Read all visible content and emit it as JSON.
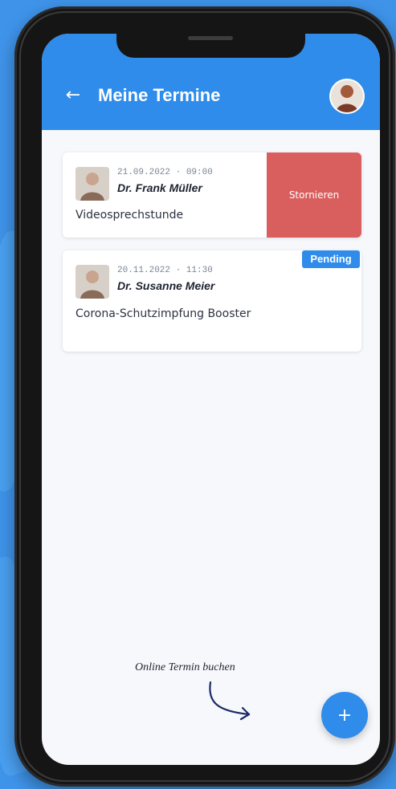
{
  "header": {
    "title": "Meine Termine",
    "back_icon": "arrow-left-icon",
    "avatar_icon": "user-avatar-icon"
  },
  "appointments": [
    {
      "date": "21.09.2022 · 09:00",
      "doctor": "Dr. Frank Müller",
      "reason": "Videosprechstunde",
      "cancel_label": "Stornieren"
    },
    {
      "date": "20.11.2022 · 11:30",
      "doctor": "Dr. Susanne Meier",
      "reason": "Corona-Schutzimpfung Booster",
      "status": "Pending"
    }
  ],
  "hint": "Online Termin buchen",
  "fab_label": "+",
  "colors": {
    "primary": "#2f8cea",
    "cancel": "#d95f5f",
    "background": "#3f94ea"
  }
}
